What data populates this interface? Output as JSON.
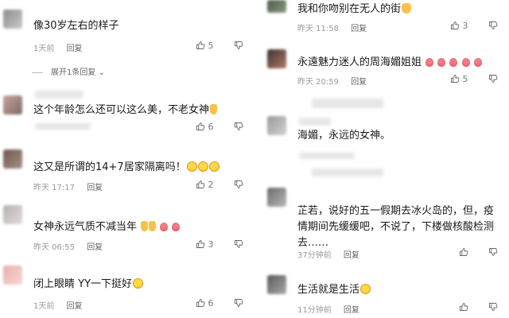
{
  "left": {
    "comments": [
      {
        "text": "像30岁左右的样子",
        "time": "1天前",
        "reply": "回复",
        "likes": "5"
      },
      {
        "text": "这个年龄怎么还可以这么美，不老女神",
        "time": "",
        "reply": "",
        "likes": "6"
      },
      {
        "text": "这又是所谓的14+7居家隔离吗！",
        "time": "昨天 17:17",
        "reply": "回复",
        "likes": "2"
      },
      {
        "text": "女神永远气质不减当年",
        "time": "昨天 06:55",
        "reply": "回复",
        "likes": "3"
      },
      {
        "text": "闭上眼睛 YY一下挺好",
        "time": "1天前",
        "reply": "回复",
        "likes": "6"
      }
    ],
    "expand_label": "展开1条回复"
  },
  "right": {
    "comments": [
      {
        "text": "我和你吻别在无人的街",
        "time": "昨天 11:58",
        "reply": "回复",
        "likes": "3"
      },
      {
        "text": "永遠魅力迷人的周海媚姐姐",
        "time": "昨天 20:59",
        "reply": "回复",
        "likes": "5"
      },
      {
        "text": "海媚，永远的女神。",
        "time": "",
        "reply": "",
        "likes": ""
      },
      {
        "text": "芷若，说好的五一假期去冰火岛的，但，疫情期间先缓缓吧，不说了，下楼做核酸检测去……",
        "time": "37分钟前",
        "reply": "回复",
        "likes": ""
      },
      {
        "text": "生活就是生活",
        "time": "11分钟前",
        "reply": "回复",
        "likes": ""
      }
    ]
  },
  "icons": {
    "like": "thumbs-up-icon",
    "dislike": "thumbs-down-icon"
  },
  "colors": {
    "text": "#1a1a1a",
    "meta": "#9a9a9a",
    "emoji_yellow": "#ffd94a",
    "rose": "#d43a4a"
  }
}
